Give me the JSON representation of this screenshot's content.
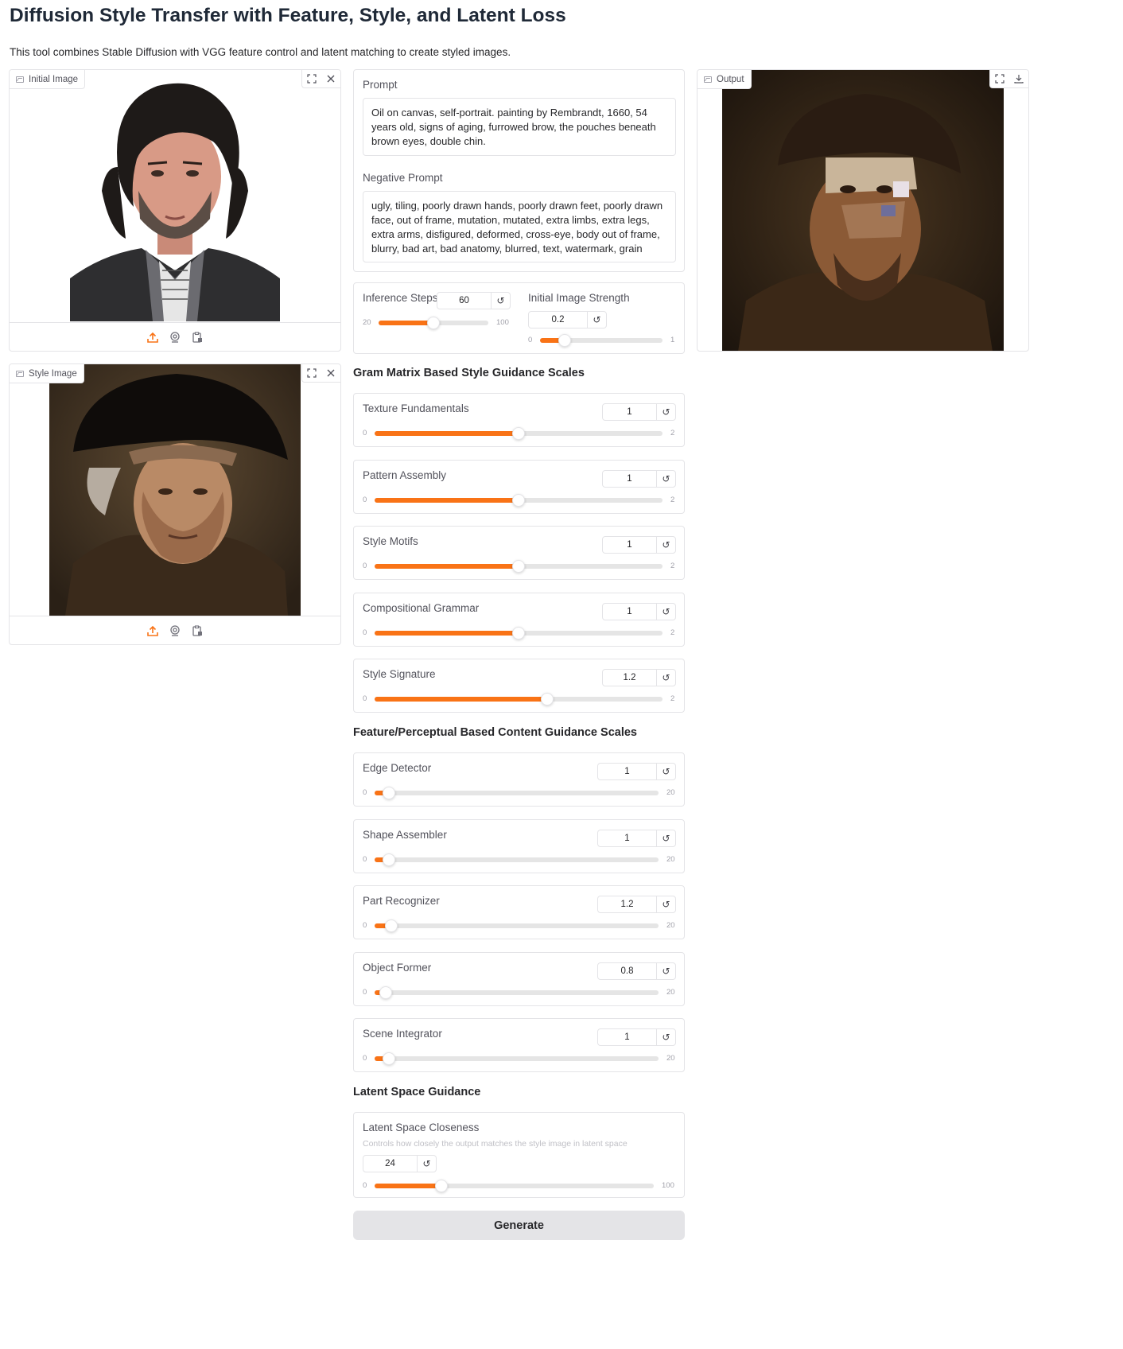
{
  "header": {
    "title": "Diffusion Style Transfer with Feature, Style, and Latent Loss",
    "description": "This tool combines Stable Diffusion with VGG feature control and latent matching to create styled images."
  },
  "initial_image": {
    "label": "Initial Image"
  },
  "style_image": {
    "label": "Style Image"
  },
  "output": {
    "label": "Output"
  },
  "prompt": {
    "label": "Prompt",
    "value": "Oil on canvas, self-portrait. painting by Rembrandt, 1660,  54 years old, signs of aging, furrowed brow, the pouches beneath brown eyes, double chin."
  },
  "negative_prompt": {
    "label": "Negative Prompt",
    "value": "ugly, tiling, poorly drawn hands, poorly drawn feet, poorly drawn face, out of frame, mutation, mutated, extra limbs, extra legs, extra arms, disfigured, deformed, cross-eye, body out of frame, blurry, bad art, bad anatomy, blurred, text, watermark, grain"
  },
  "inference_steps": {
    "label": "Inference Steps",
    "value": "60",
    "min": "20",
    "max": "100",
    "fraction": 0.5
  },
  "initial_strength": {
    "label": "Initial Image Strength",
    "value": "0.2",
    "min": "0",
    "max": "1",
    "fraction": 0.2
  },
  "gram_section": {
    "title": "Gram Matrix Based Style Guidance Scales",
    "sliders": [
      {
        "label": "Texture Fundamentals",
        "value": "1",
        "min": "0",
        "max": "2",
        "fraction": 0.5
      },
      {
        "label": "Pattern Assembly",
        "value": "1",
        "min": "0",
        "max": "2",
        "fraction": 0.5
      },
      {
        "label": "Style Motifs",
        "value": "1",
        "min": "0",
        "max": "2",
        "fraction": 0.5
      },
      {
        "label": "Compositional Grammar",
        "value": "1",
        "min": "0",
        "max": "2",
        "fraction": 0.5
      },
      {
        "label": "Style Signature",
        "value": "1.2",
        "min": "0",
        "max": "2",
        "fraction": 0.6
      }
    ]
  },
  "feature_section": {
    "title": "Feature/Perceptual Based Content Guidance Scales",
    "sliders": [
      {
        "label": "Edge Detector",
        "value": "1",
        "min": "0",
        "max": "20",
        "fraction": 0.05
      },
      {
        "label": "Shape Assembler",
        "value": "1",
        "min": "0",
        "max": "20",
        "fraction": 0.05
      },
      {
        "label": "Part Recognizer",
        "value": "1.2",
        "min": "0",
        "max": "20",
        "fraction": 0.06
      },
      {
        "label": "Object Former",
        "value": "0.8",
        "min": "0",
        "max": "20",
        "fraction": 0.04
      },
      {
        "label": "Scene Integrator",
        "value": "1",
        "min": "0",
        "max": "20",
        "fraction": 0.05
      }
    ]
  },
  "latent_section": {
    "title": "Latent Space Guidance",
    "label": "Latent Space Closeness",
    "info": "Controls how closely the output matches the style image in latent space",
    "value": "24",
    "min": "0",
    "max": "100",
    "fraction": 0.24
  },
  "generate_label": "Generate",
  "icons": {
    "reset": "reset-icon",
    "upload": "upload-icon",
    "webcam": "webcam-icon",
    "clipboard": "clipboard-icon",
    "fullscreen": "fullscreen-icon",
    "close": "close-icon",
    "download": "download-icon"
  },
  "colors": {
    "accent": "#f97316",
    "track": "#e5e5e5",
    "border": "#e4e4e7"
  }
}
